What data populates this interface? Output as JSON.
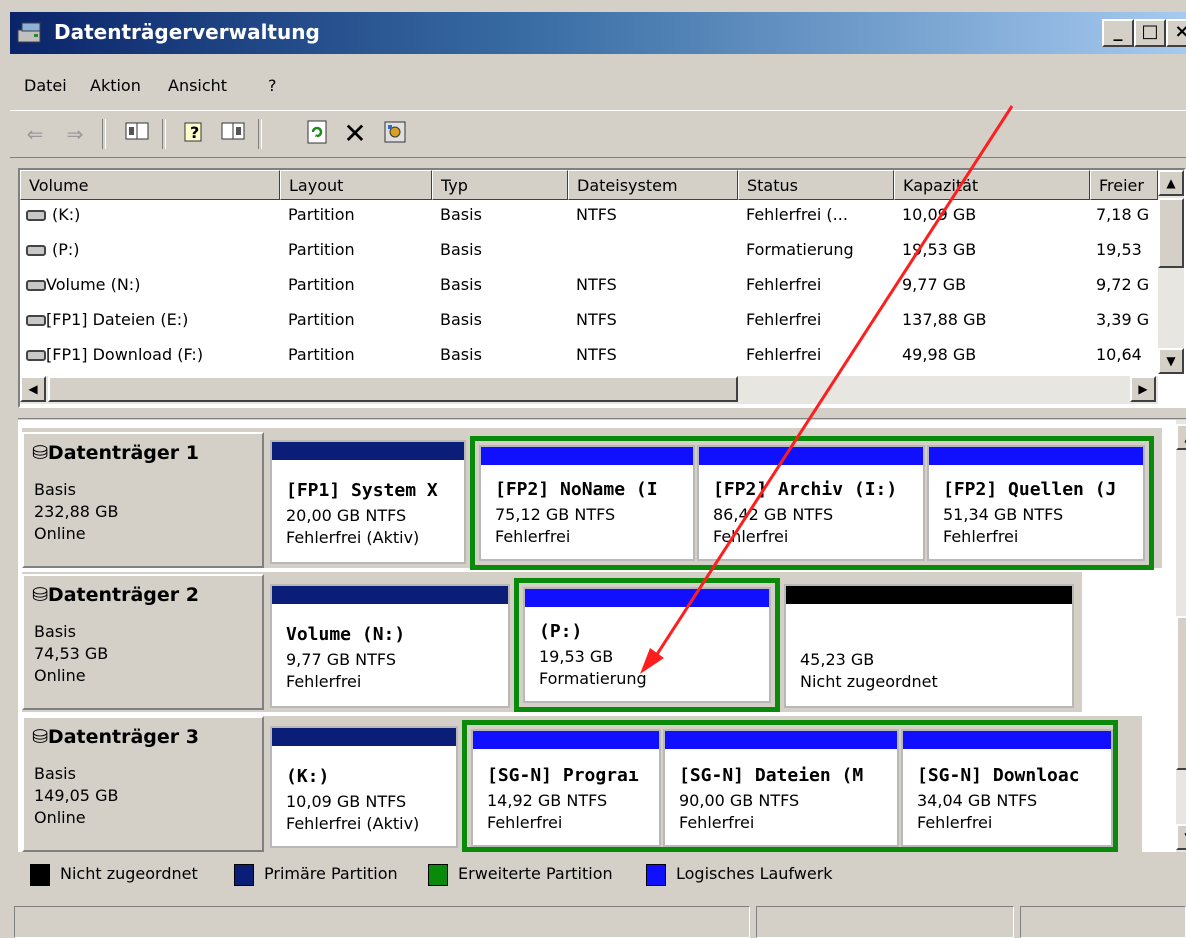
{
  "window": {
    "title": "Datenträgerverwaltung"
  },
  "menu": [
    "Datei",
    "Aktion",
    "Ansicht",
    "?"
  ],
  "toolbar": [
    "back-icon",
    "forward-icon",
    "view-icon",
    "help-icon",
    "properties-icon",
    "refresh-icon",
    "delete-icon",
    "settings-icon"
  ],
  "columns": [
    "Volume",
    "Layout",
    "Typ",
    "Dateisystem",
    "Status",
    "Kapazität",
    "Freier"
  ],
  "volumes": [
    {
      "name": "(K:)",
      "layout": "Partition",
      "typ": "Basis",
      "fs": "NTFS",
      "status": "Fehlerfrei (...",
      "cap": "10,09 GB",
      "free": "7,18 G"
    },
    {
      "name": "(P:)",
      "layout": "Partition",
      "typ": "Basis",
      "fs": "",
      "status": "Formatierung",
      "cap": "19,53 GB",
      "free": "19,53"
    },
    {
      "name": "Volume (N:)",
      "layout": "Partition",
      "typ": "Basis",
      "fs": "NTFS",
      "status": "Fehlerfrei",
      "cap": "9,77 GB",
      "free": "9,72 G"
    },
    {
      "name": "[FP1] Dateien (E:)",
      "layout": "Partition",
      "typ": "Basis",
      "fs": "NTFS",
      "status": "Fehlerfrei",
      "cap": "137,88 GB",
      "free": "3,39 G"
    },
    {
      "name": "[FP1] Download (F:)",
      "layout": "Partition",
      "typ": "Basis",
      "fs": "NTFS",
      "status": "Fehlerfrei",
      "cap": "49,98 GB",
      "free": "10,64"
    }
  ],
  "disks": [
    {
      "name": "Datenträger 1",
      "type": "Basis",
      "size": "232,88 GB",
      "state": "Online",
      "partitions": [
        {
          "title": "[FP1] System X",
          "info": "20,00 GB NTFS",
          "status": "Fehlerfrei (Aktiv)"
        },
        {
          "title": "[FP2] NoName  (I",
          "info": "75,12 GB NTFS",
          "status": "Fehlerfrei"
        },
        {
          "title": "[FP2] Archiv  (I:)",
          "info": "86,42 GB NTFS",
          "status": "Fehlerfrei"
        },
        {
          "title": "[FP2] Quellen  (J",
          "info": "51,34 GB NTFS",
          "status": "Fehlerfrei"
        }
      ]
    },
    {
      "name": "Datenträger 2",
      "type": "Basis",
      "size": "74,53 GB",
      "state": "Online",
      "partitions": [
        {
          "title": "Volume  (N:)",
          "info": "9,77 GB NTFS",
          "status": "Fehlerfrei"
        },
        {
          "title": "(P:)",
          "info": "19,53 GB",
          "status": "Formatierung"
        },
        {
          "title": "",
          "info": "45,23 GB",
          "status": "Nicht zugeordnet"
        }
      ]
    },
    {
      "name": "Datenträger 3",
      "type": "Basis",
      "size": "149,05 GB",
      "state": "Online",
      "partitions": [
        {
          "title": "(K:)",
          "info": "10,09 GB NTFS",
          "status": "Fehlerfrei (Aktiv)"
        },
        {
          "title": "[SG-N] Prograı",
          "info": "14,92 GB NTFS",
          "status": "Fehlerfrei"
        },
        {
          "title": "[SG-N] Dateien  (M",
          "info": "90,00 GB NTFS",
          "status": "Fehlerfrei"
        },
        {
          "title": "[SG-N] Downloac",
          "info": "34,04 GB NTFS",
          "status": "Fehlerfrei"
        }
      ]
    }
  ],
  "legend": [
    "Nicht zugeordnet",
    "Primäre Partition",
    "Erweiterte Partition",
    "Logisches Laufwerk"
  ],
  "colors": {
    "primary": "#0a1e78",
    "logical": "#1010ff",
    "extended": "#0a8a0a",
    "unallocated": "#000000",
    "annotation": "#ff1e1e"
  }
}
